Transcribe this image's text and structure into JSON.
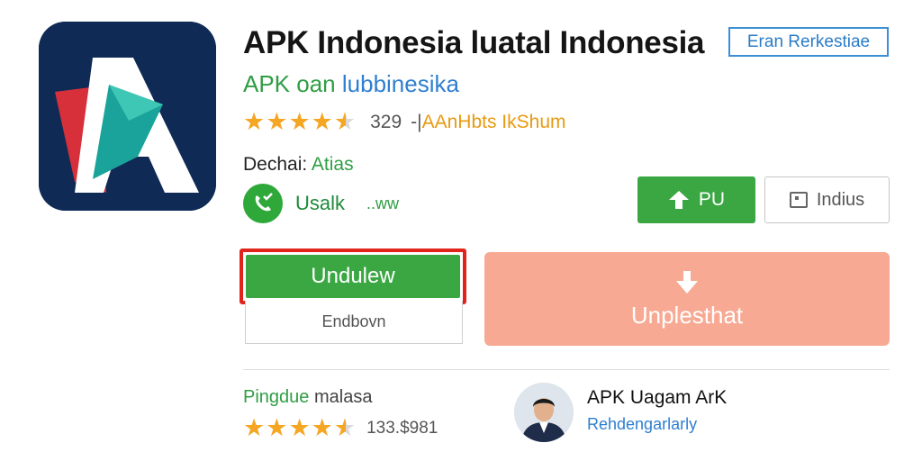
{
  "app": {
    "title": "APK Indonesia luatal Indonesia",
    "badge": "Eran Rerkestiae",
    "subtitle_green": "APK oan",
    "subtitle_blue": "lubbinesika"
  },
  "rating": {
    "value": 4.5,
    "count": "329",
    "separator": "-|",
    "extra": "AAnHbts IkShum"
  },
  "developer": {
    "label": "Dechai:",
    "name": "Atias"
  },
  "verify": {
    "label": "Usalk",
    "extra": "..ww"
  },
  "buttons": {
    "share_label": "PU",
    "wishlist_label": "Indius",
    "install_label": "Undulew",
    "secondary_label": "Endbovn",
    "download_label": "Unplesthat"
  },
  "review": {
    "label_green": "Pingdue",
    "label_dark": "malasa",
    "rating_value": 4.5,
    "count": "133.$981"
  },
  "author": {
    "name": "APK Uagam ArK",
    "role": "Rehdengarlarly"
  },
  "colors": {
    "primary_green": "#3aa743",
    "install_outline": "#e0241b",
    "download_bg": "#f7a993",
    "star": "#f5a623",
    "link_blue": "#2f7fd0",
    "icon_bg": "#0f2a55"
  },
  "icons": {
    "app": "letter-a-app-icon",
    "verify": "verified-phone-icon",
    "share": "upload-arrow-icon",
    "wishlist": "wishlist-box-icon",
    "download": "download-arrow-icon"
  }
}
